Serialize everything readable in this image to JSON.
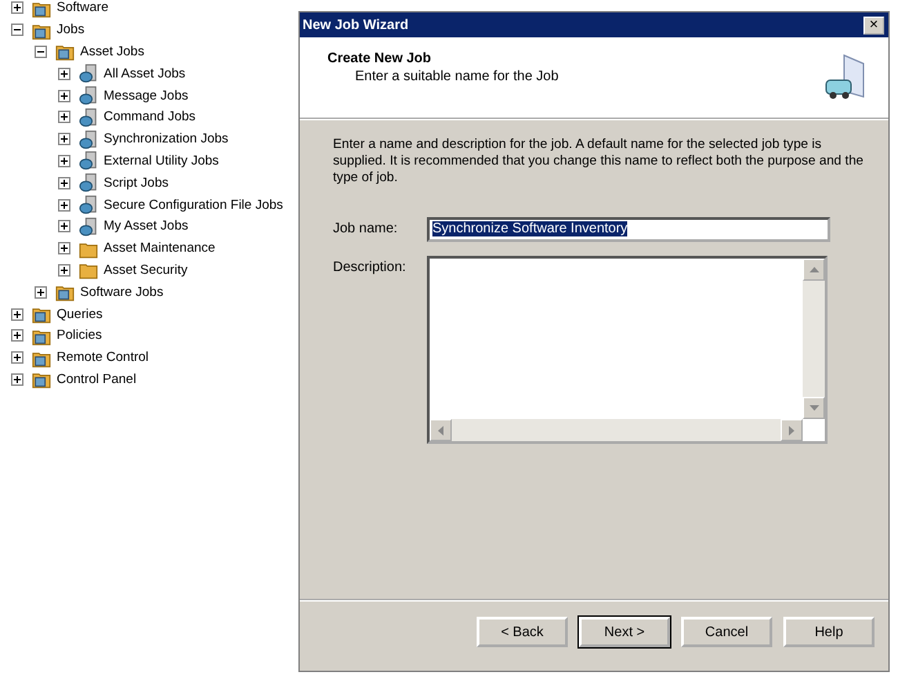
{
  "tree": [
    {
      "label": "Software",
      "kind": "folder",
      "expanded": false
    },
    {
      "label": "Jobs",
      "kind": "folder",
      "expanded": true,
      "children": [
        {
          "label": "Asset Jobs",
          "kind": "folder",
          "expanded": true,
          "children": [
            {
              "label": "All Asset Jobs",
              "kind": "job",
              "expanded": false
            },
            {
              "label": "Message Jobs",
              "kind": "job",
              "expanded": false
            },
            {
              "label": "Command Jobs",
              "kind": "job",
              "expanded": false
            },
            {
              "label": "Synchronization Jobs",
              "kind": "job",
              "expanded": false
            },
            {
              "label": "External Utility Jobs",
              "kind": "job",
              "expanded": false
            },
            {
              "label": "Script Jobs",
              "kind": "job",
              "expanded": false
            },
            {
              "label": "Secure Configuration File Jobs",
              "kind": "job",
              "expanded": false
            },
            {
              "label": "My Asset Jobs",
              "kind": "job",
              "expanded": false
            },
            {
              "label": "Asset Maintenance",
              "kind": "folder",
              "expanded": false
            },
            {
              "label": "Asset Security",
              "kind": "folder",
              "expanded": false
            }
          ]
        },
        {
          "label": "Software Jobs",
          "kind": "folder",
          "expanded": false
        }
      ]
    },
    {
      "label": "Queries",
      "kind": "folder",
      "expanded": false
    },
    {
      "label": "Policies",
      "kind": "folder",
      "expanded": false
    },
    {
      "label": "Remote Control",
      "kind": "folder",
      "expanded": false
    },
    {
      "label": "Control Panel",
      "kind": "folder",
      "expanded": false
    }
  ],
  "dialog": {
    "title": "New Job Wizard",
    "close": "×",
    "heading": "Create New Job",
    "subheading": "Enter a suitable name for the Job",
    "intro": "Enter a name and description for the job. A default name for the selected job type is supplied. It is recommended that you change this name to reflect both the purpose and the type of job.",
    "job_name": {
      "label": "Job name:",
      "value": "Synchronize Software Inventory",
      "selected": true
    },
    "description": {
      "label": "Description:"
    },
    "buttons": [
      {
        "label": "< Back",
        "default": false
      },
      {
        "label": "Next >",
        "default": true
      },
      {
        "label": "Cancel",
        "default": false
      },
      {
        "label": "Help",
        "default": false
      }
    ]
  }
}
